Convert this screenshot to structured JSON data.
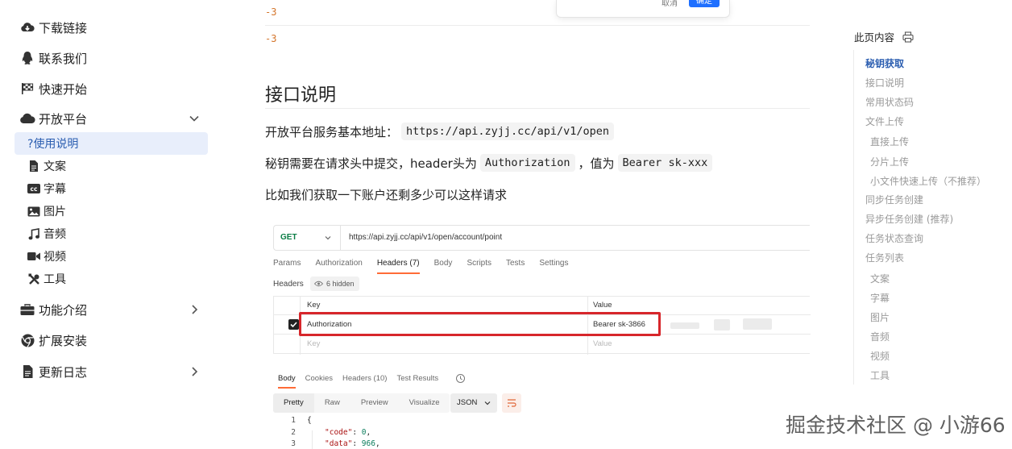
{
  "sidebar": {
    "items": [
      {
        "label": "下载链接",
        "icon": "cloud-download-icon"
      },
      {
        "label": "联系我们",
        "icon": "qq-penguin-icon"
      },
      {
        "label": "快速开始",
        "icon": "checkered-flag-icon"
      },
      {
        "label": "开放平台",
        "icon": "cloud-icon",
        "expanded": true
      },
      {
        "label": "功能介绍",
        "icon": "toolbox-icon"
      },
      {
        "label": "扩展安装",
        "icon": "chrome-icon"
      },
      {
        "label": "更新日志",
        "icon": "document-icon"
      }
    ],
    "sub_items": [
      {
        "label": "使用说明",
        "icon": "question-icon",
        "active": true
      },
      {
        "label": "文案",
        "icon": "file-icon"
      },
      {
        "label": "字幕",
        "icon": "cc-icon"
      },
      {
        "label": "图片",
        "icon": "image-icon"
      },
      {
        "label": "音频",
        "icon": "music-icon"
      },
      {
        "label": "视频",
        "icon": "video-icon"
      },
      {
        "label": "工具",
        "icon": "tools-icon"
      }
    ]
  },
  "dialog": {
    "cancel": "取消",
    "confirm": "确定"
  },
  "main": {
    "neg_values": [
      "-3",
      "-3"
    ],
    "heading": "接口说明",
    "p1_text": "开放平台服务基本地址：",
    "p1_code": "https://api.zyjj.cc/api/v1/open",
    "p2_pre": "秘钥需要在请求头中提交，header头为",
    "p2_code1": "Authorization",
    "p2_mid": "，值为",
    "p2_code2": "Bearer sk-xxx",
    "p3": "比如我们获取一下账户还剩多少可以这样请求"
  },
  "postman": {
    "method": "GET",
    "url": "https://api.zyjj.cc/api/v1/open/account/point",
    "tabs": [
      "Params",
      "Authorization",
      "Headers (7)",
      "Body",
      "Scripts",
      "Tests",
      "Settings"
    ],
    "active_tab": "Headers (7)",
    "headers_label": "Headers",
    "hidden_label": "6 hidden",
    "col_key": "Key",
    "col_value": "Value",
    "row_key": "Authorization",
    "row_value": "Bearer sk-3866",
    "placeholder_key": "Key",
    "placeholder_value": "Value",
    "response_tabs": [
      "Body",
      "Cookies",
      "Headers (10)",
      "Test Results"
    ],
    "format_buttons": [
      "Pretty",
      "Raw",
      "Preview",
      "Visualize"
    ],
    "format_type": "JSON",
    "code_lines": [
      {
        "n": "1",
        "text": "{"
      },
      {
        "n": "2",
        "key": "\"code\"",
        "value": "0"
      },
      {
        "n": "3",
        "key": "\"data\"",
        "value": "966"
      }
    ]
  },
  "toc": {
    "title": "此页内容",
    "items": [
      {
        "label": "秘钥获取",
        "level": 1,
        "active": true
      },
      {
        "label": "接口说明",
        "level": 1
      },
      {
        "label": "常用状态码",
        "level": 1
      },
      {
        "label": "文件上传",
        "level": 1
      },
      {
        "label": "直接上传",
        "level": 2
      },
      {
        "label": "分片上传",
        "level": 2
      },
      {
        "label": "小文件快速上传（不推荐）",
        "level": 2
      },
      {
        "label": "同步任务创建",
        "level": 1
      },
      {
        "label": "异步任务创建 (推荐)",
        "level": 1
      },
      {
        "label": "任务状态查询",
        "level": 1
      },
      {
        "label": "任务列表",
        "level": 1
      },
      {
        "label": "文案",
        "level": 2
      },
      {
        "label": "字幕",
        "level": 2
      },
      {
        "label": "图片",
        "level": 2
      },
      {
        "label": "音频",
        "level": 2
      },
      {
        "label": "视频",
        "level": 2
      },
      {
        "label": "工具",
        "level": 2
      }
    ]
  },
  "watermark": "掘金技术社区 @ 小游66",
  "colors": {
    "accent": "#2a5db0",
    "active_bg": "#e8eefb",
    "highlight_box": "#d7262b",
    "postman_orange": "#ff6c37",
    "method_green": "#0a7d45"
  }
}
